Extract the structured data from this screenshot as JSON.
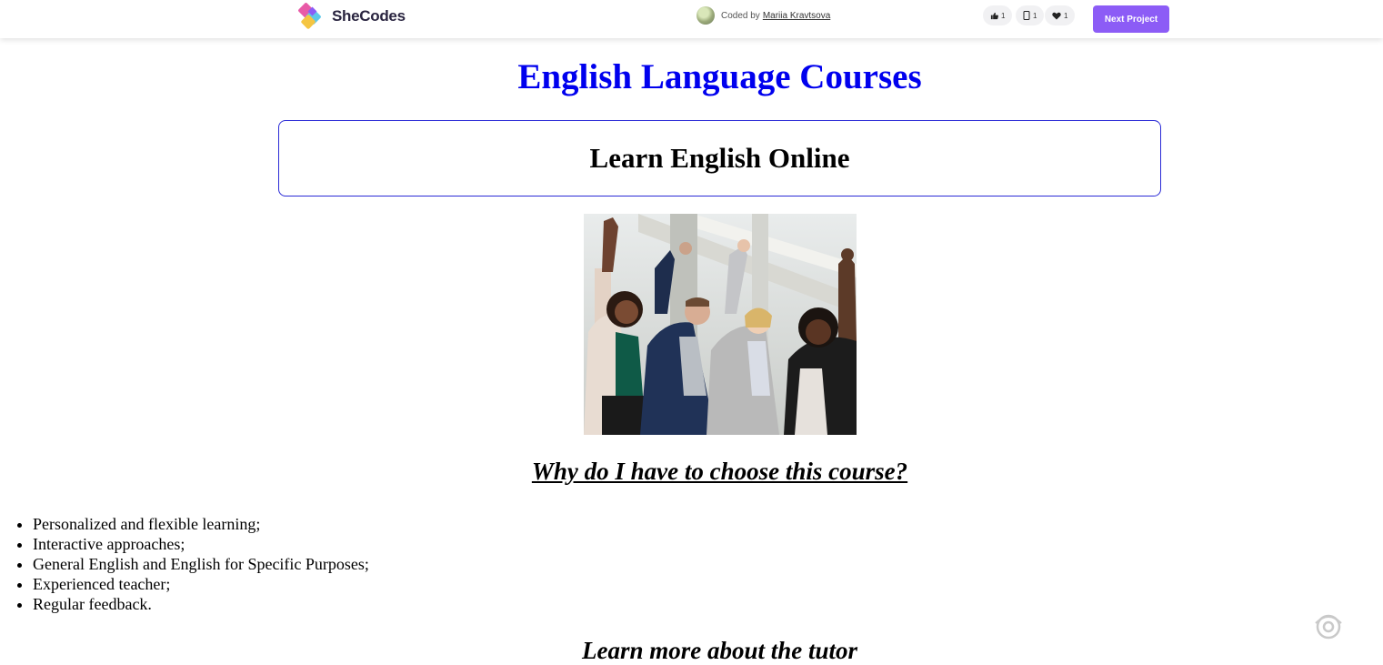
{
  "topbar": {
    "brand_name": "SheCodes",
    "coded_by_label": "Coded by",
    "author_name": "Mariia Kravtsova",
    "likes_count": "1",
    "views_count": "1",
    "hearts_count": "1",
    "next_project_label": "Next Project"
  },
  "page": {
    "title": "English Language Courses",
    "subtitle": "Learn English Online",
    "why_heading": "Why do I have to choose this course?",
    "benefits": [
      "Personalized and flexible learning;",
      "Interactive approaches;",
      "General English and English for Specific Purposes;",
      "Experienced teacher;",
      "Regular feedback."
    ],
    "tutor_heading": "Learn more about the tutor"
  },
  "colors": {
    "title_blue": "#0000ee",
    "box_border": "#2b2bd6",
    "button_purple": "#8c5cf6"
  },
  "icons": {
    "like": "thumbs-up-icon",
    "view": "eye-icon",
    "heart": "heart-icon"
  }
}
